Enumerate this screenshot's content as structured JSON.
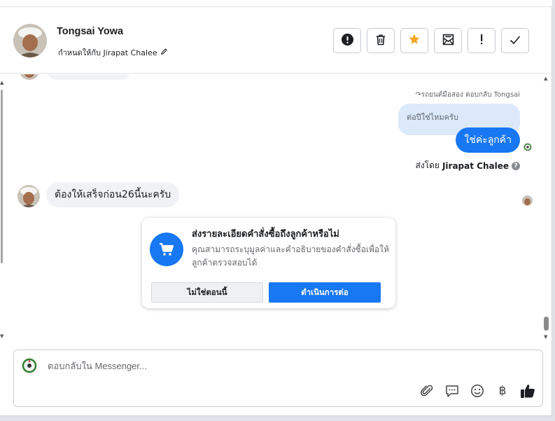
{
  "contact": {
    "name": "Tongsai Yowa",
    "assign_text": "กำหนดให้กับ Jirapat Chalee"
  },
  "header_actions": [
    {
      "name": "spam-button",
      "icon": "exclamation-circle-icon"
    },
    {
      "name": "delete-button",
      "icon": "trash-icon"
    },
    {
      "name": "star-button",
      "icon": "star-icon"
    },
    {
      "name": "mark-unread-button",
      "icon": "envelope-icon"
    },
    {
      "name": "follow-up-button",
      "icon": "exclamation-icon"
    },
    {
      "name": "done-button",
      "icon": "check-icon"
    }
  ],
  "messages": {
    "reply_reference": "รถยนต์มือสอง ตอบกลับ Tongsai",
    "quoted_text": "ต่อปีใช่ไหมครับ",
    "sent_text": "ใช่ค่ะลูกค้า",
    "sent_by_prefix": "ส่งโดย",
    "sent_by_name": "Jirapat Chalee",
    "incoming_text": "ต้องให้เสร็จก่อน26นี้นะครับ"
  },
  "prompt_card": {
    "title": "ส่งรายละเอียดคำสั่งซื้อถึงลูกค้าหรือไม่",
    "description": "คุณสามารถระบุมูลค่าและคำอธิบายของคำสั่งซื้อเพื่อให้ลูกค้าตรวจสอบได้",
    "dismiss_label": "ไม่ใช่ตอนนี้",
    "confirm_label": "ดำเนินการต่อ"
  },
  "composer": {
    "placeholder": "ตอบกลับใน Messenger...",
    "tools": [
      "paperclip-icon",
      "speech-bubble-icon",
      "smiley-icon",
      "baht-icon",
      "thumbs-up-icon"
    ]
  },
  "colors": {
    "accent": "#1877f2",
    "star": "#f5a623",
    "quoted_bg": "#dbe9fb",
    "incoming_bg": "#f0f2f5"
  }
}
